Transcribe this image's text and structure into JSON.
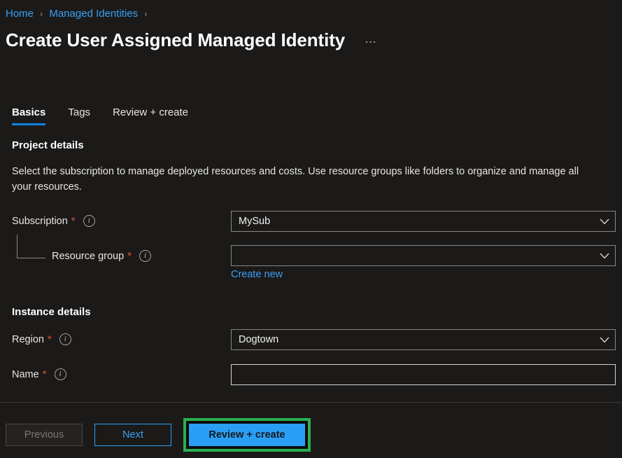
{
  "breadcrumb": {
    "items": [
      {
        "label": "Home",
        "separator": "›"
      },
      {
        "label": "Managed Identities",
        "separator": "›"
      }
    ]
  },
  "header": {
    "title": "Create User Assigned Managed Identity",
    "more_menu": "…",
    "more_menu_icon": "ellipsis-icon"
  },
  "tabs": [
    {
      "label": "Basics",
      "active": true
    },
    {
      "label": "Tags",
      "active": false
    },
    {
      "label": "Review + create",
      "active": false
    }
  ],
  "project_details": {
    "heading": "Project details",
    "description": "Select the subscription to manage deployed resources and costs. Use resource groups like folders to organize and manage all your resources.",
    "subscription": {
      "label": "Subscription",
      "required_marker": "*",
      "info_icon": "info-icon",
      "value": "MySub",
      "chevron_icon": "chevron-down-icon"
    },
    "resource_group": {
      "label": "Resource group",
      "required_marker": "*",
      "info_icon": "info-icon",
      "value": "",
      "chevron_icon": "chevron-down-icon",
      "create_new_label": "Create new"
    }
  },
  "instance_details": {
    "heading": "Instance details",
    "region": {
      "label": "Region",
      "required_marker": "*",
      "info_icon": "info-icon",
      "value": "Dogtown",
      "chevron_icon": "chevron-down-icon"
    },
    "name": {
      "label": "Name",
      "required_marker": "*",
      "info_icon": "info-icon",
      "value": "",
      "placeholder": ""
    }
  },
  "footer": {
    "previous_label": "Previous",
    "next_label": "Next",
    "review_create_label": "Review + create"
  },
  "colors": {
    "page_background": "#1b1a19",
    "link_blue": "#3aa0f3",
    "accent_blue": "#2a9df4",
    "tab_underline": "#0f82e0",
    "required_red": "#e74c3c",
    "highlight_green": "#2ab04f",
    "border_gray": "#8a8886"
  }
}
